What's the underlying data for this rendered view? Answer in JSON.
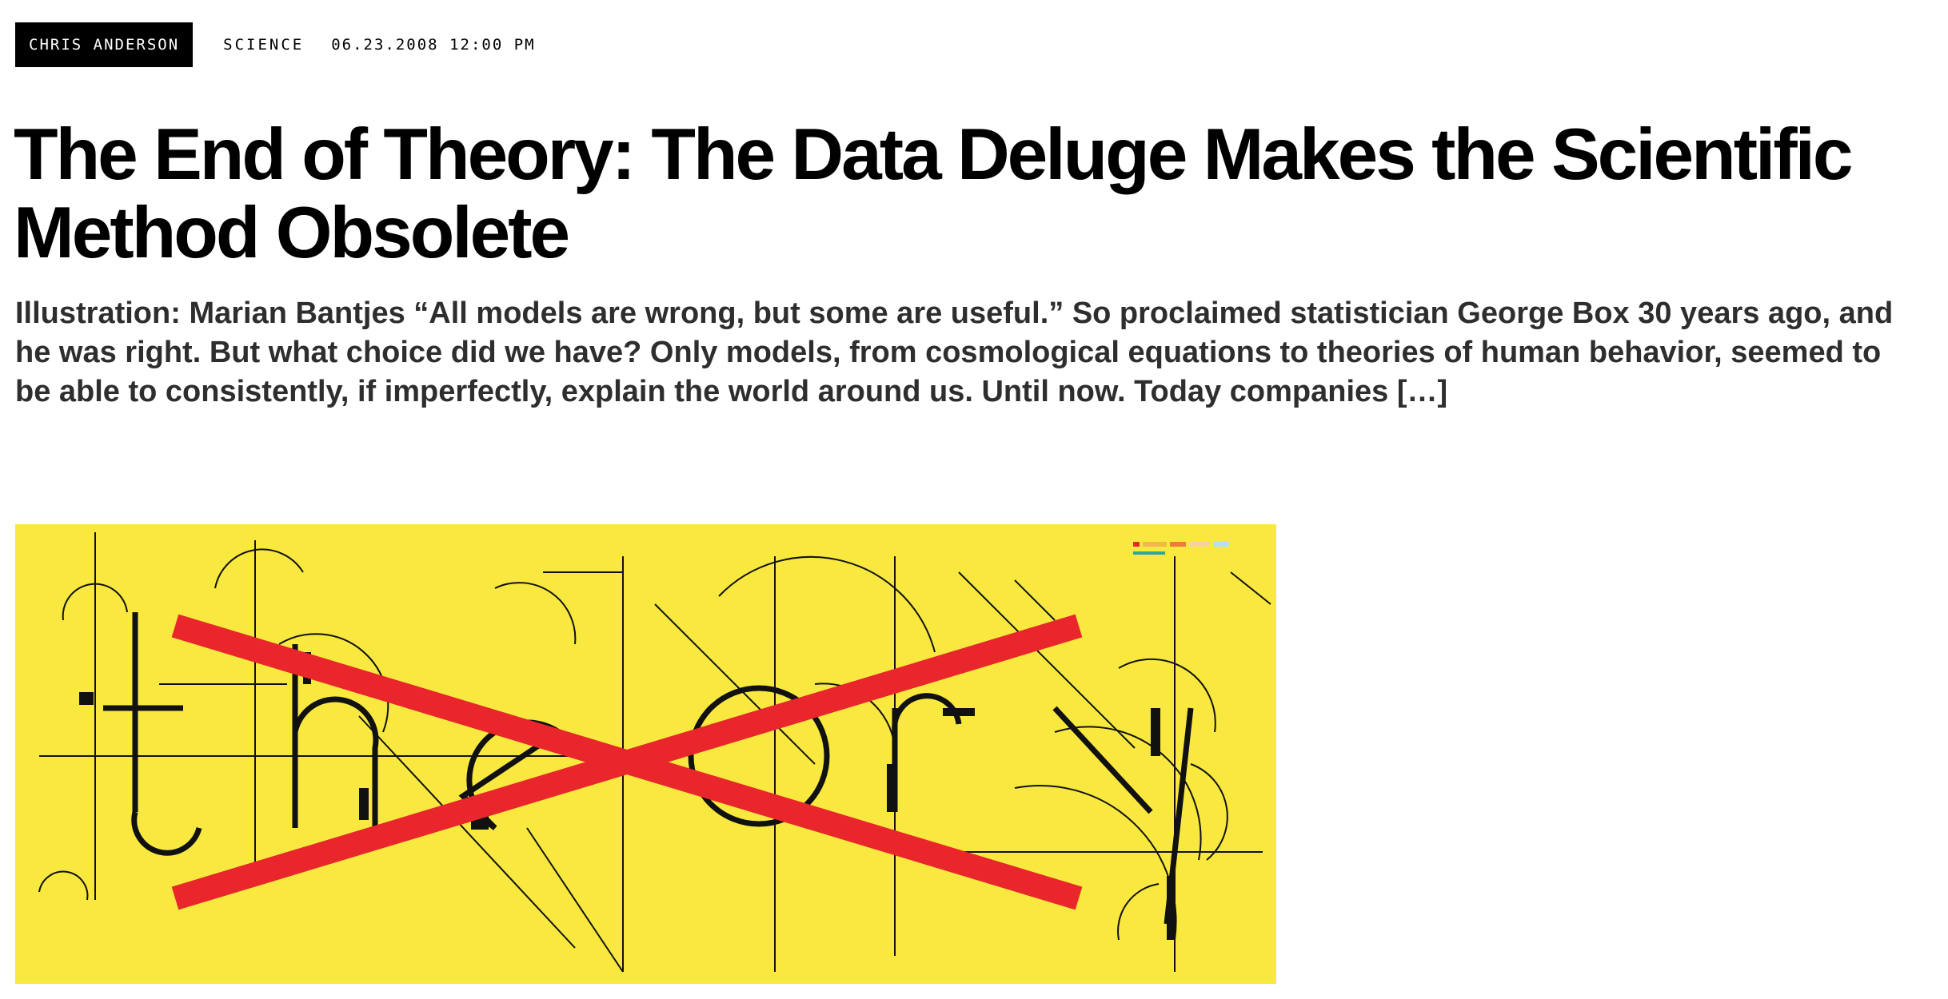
{
  "byline": {
    "author": "CHRIS ANDERSON",
    "category": "SCIENCE",
    "date": "06.23.2008 12:00 PM"
  },
  "article": {
    "title": "The End of Theory: The Data Deluge Makes the Scientific Method Obsolete",
    "dek": "Illustration: Marian Bantjes “All models are wrong, but some are useful.” So proclaimed statistician George Box 30 years ago, and he was right. But what choice did we have? Only models, from cosmological equations to theories of human behavior, seemed to be able to consistently, if imperfectly, explain the world around us. Until now. Today companies […]"
  },
  "hero_image": {
    "background_color": "#f8e83f",
    "cross_color": "#e8262c",
    "line_color": "#111111"
  }
}
